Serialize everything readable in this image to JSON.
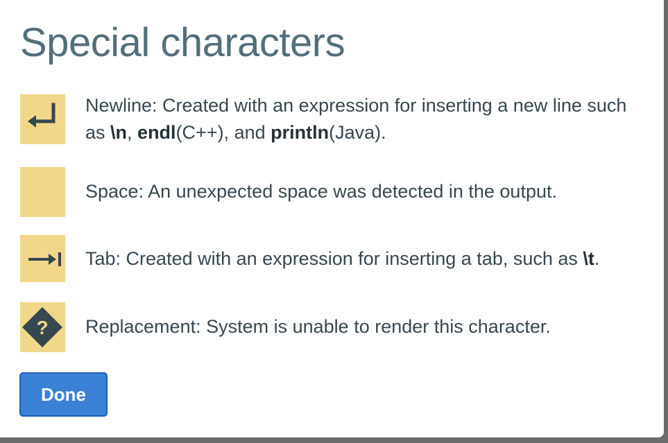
{
  "dialog": {
    "title": "Special characters",
    "items": [
      {
        "icon": "newline-return-arrow-icon",
        "label": "Newline",
        "text_a": ": Created with an expression for inserting a new line such as ",
        "code_1": "\\n",
        "sep_1": ", ",
        "code_2": "endl",
        "lang_2": "(C++), and ",
        "code_3": "println",
        "lang_3": "(Java)."
      },
      {
        "icon": "space-blank-icon",
        "label": "Space",
        "text_a": ": An unexpected space was detected in the output."
      },
      {
        "icon": "tab-arrow-to-bar-icon",
        "label": "Tab",
        "text_a": ": Created with an expression for inserting a tab, such as ",
        "code_1": "\\t",
        "text_b": "."
      },
      {
        "icon": "replacement-question-diamond-icon",
        "label": "Replacement",
        "text_a": ": System is unable to render this character.",
        "glyph": "?"
      }
    ],
    "done_label": "Done"
  },
  "colors": {
    "title": "#546e7a",
    "chip": "#f0d78a",
    "icon": "#37474f",
    "button": "#3b82d6",
    "button_border": "#1f5fb0"
  }
}
